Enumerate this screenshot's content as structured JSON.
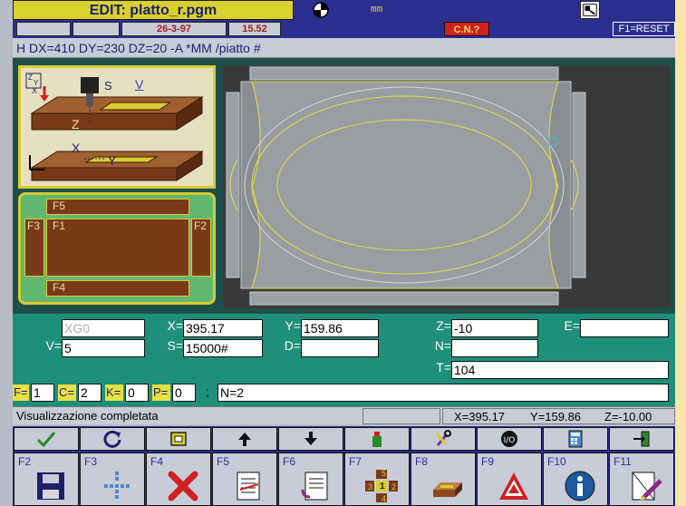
{
  "window": {
    "title_prefix": "EDIT: ",
    "title_file": "platto_r.pgm",
    "unit": "mm"
  },
  "infobar": {
    "date": "26-3-97",
    "time": "15.52",
    "cn_label": "C.N.?",
    "reset_label": "F1=RESET"
  },
  "program_line": "H DX=410 DY=230 DZ=20 -A *MM /piatto #",
  "tool_panel": {
    "axis_s": "S",
    "axis_v": "V",
    "axis_z": "Z",
    "axis_x": "X",
    "axis_y": "Y",
    "corner_z": "Z",
    "corner_y": "Y",
    "corner_x": "X"
  },
  "faces": {
    "f5": "F5",
    "f1": "F1",
    "f3": "F3",
    "f2": "F2",
    "f4": "F4"
  },
  "fields": {
    "g_code": "XG0",
    "v_label": "V=",
    "v_value": "5",
    "x_label": "X=",
    "x_value": "395.17",
    "s_label": "S=",
    "s_value": "15000#",
    "y_label": "Y=",
    "y_value": "159.86",
    "d_label": "D=",
    "d_value": "",
    "z_label": "Z=",
    "z_value": "-10",
    "n_label": "N=",
    "n_value": "",
    "t_label": "T=",
    "t_value": "104",
    "e_label": "E=",
    "e_value": "",
    "f_label": "F=",
    "f_value": "1",
    "c_label": "C=",
    "c_value": "2",
    "k_label": "K=",
    "k_value": "0",
    "p_label": "P=",
    "p_value": "0",
    "semicolon": ";",
    "comment": "N=2"
  },
  "status": {
    "message": "Visualizzazione completata",
    "x": "X=395.17",
    "y": "Y=159.86",
    "z": "Z=-10.00"
  },
  "toolbar_icons": [
    "check-icon",
    "refresh-icon",
    "frame-icon",
    "arrow-up-icon",
    "arrow-down-icon",
    "paint-icon",
    "tools-icon",
    "io-icon",
    "calculator-icon",
    "exit-icon"
  ],
  "fkeys": {
    "f2": "F2",
    "f3": "F3",
    "f4": "F4",
    "f5": "F5",
    "f6": "F6",
    "f7": "F7",
    "f8": "F8",
    "f9": "F9",
    "f10": "F10",
    "f11": "F11"
  },
  "face_cube": {
    "top": "5",
    "left": "3",
    "center": "1",
    "right": "2",
    "bottom": "4"
  },
  "colors": {
    "title_bg": "#d9d12e",
    "bar_bg": "#2b2f8f",
    "field_area": "#1e8f7a",
    "piece_outline": "#e8e040"
  }
}
